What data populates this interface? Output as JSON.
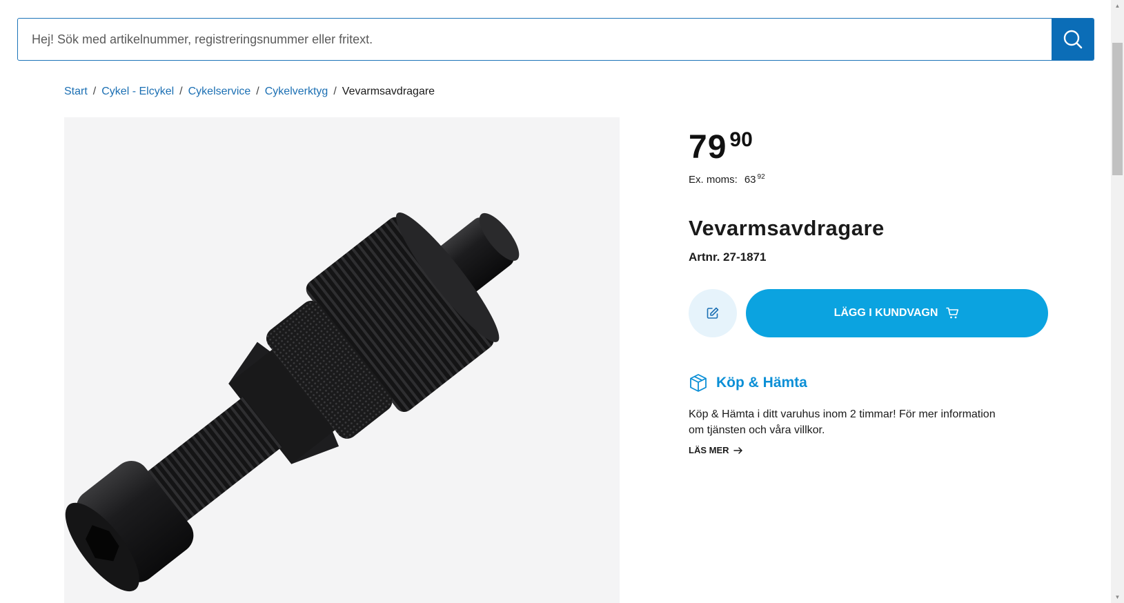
{
  "search": {
    "placeholder": "Hej! Sök med artikelnummer, registreringsnummer eller fritext.",
    "button_icon": "search-icon"
  },
  "breadcrumb": {
    "items": [
      "Start",
      "Cykel - Elcykel",
      "Cykelservice",
      "Cykelverktyg"
    ],
    "separator": "/",
    "current": "Vevarmsavdragare"
  },
  "product": {
    "image_icon": "crank-puller-tool-image",
    "price_int": "79",
    "price_dec": "90",
    "exmoms_label": "Ex. moms:",
    "exmoms_int": "63",
    "exmoms_dec": "92",
    "title": "Vevarmsavdragare",
    "artnr": "Artnr. 27-1871"
  },
  "actions": {
    "note_icon": "edit-icon",
    "add_to_cart_label": "LÄGG I KUNDVAGN",
    "cart_icon": "cart-icon"
  },
  "pickup": {
    "icon": "box-icon",
    "title": "Köp & Hämta",
    "text": "Köp & Hämta i ditt varuhus inom 2 timmar! För mer information om tjänsten och våra villkor.",
    "read_more": "LÄS MER",
    "read_more_icon": "arrow-right-icon"
  },
  "colors": {
    "primary_blue": "#0b6db7",
    "cart_button": "#0ba3e0",
    "pickup_title": "#0b8fd6",
    "link": "#1b6fb3",
    "note_button_bg": "#e6f3fb"
  }
}
